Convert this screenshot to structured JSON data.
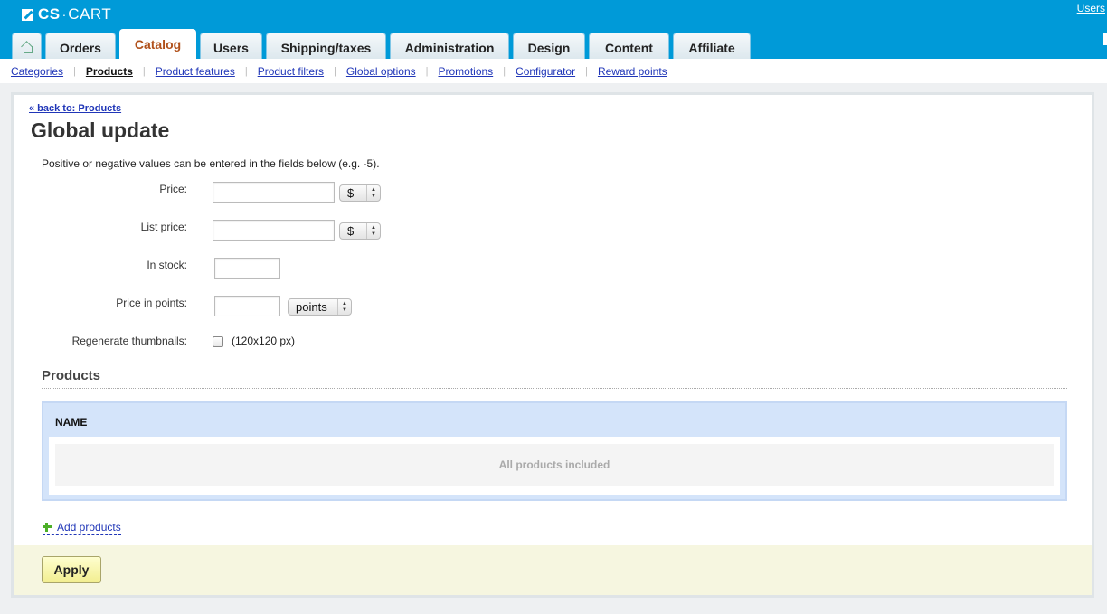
{
  "header": {
    "logo_cs": "CS",
    "logo_dot": "·",
    "logo_cart": "CART",
    "users_link": "Users",
    "tabs": [
      {
        "label": "Orders"
      },
      {
        "label": "Catalog"
      },
      {
        "label": "Users"
      },
      {
        "label": "Shipping/taxes"
      },
      {
        "label": "Administration"
      },
      {
        "label": "Design"
      },
      {
        "label": "Content"
      },
      {
        "label": "Affiliate"
      }
    ],
    "active_tab": "Catalog"
  },
  "subnav": {
    "items": [
      {
        "label": "Categories"
      },
      {
        "label": "Products"
      },
      {
        "label": "Product features"
      },
      {
        "label": "Product filters"
      },
      {
        "label": "Global options"
      },
      {
        "label": "Promotions"
      },
      {
        "label": "Configurator"
      },
      {
        "label": "Reward points"
      }
    ],
    "active": "Products"
  },
  "page": {
    "back_link": "« back to: Products",
    "title": "Global update",
    "hint": "Positive or negative values can be entered in the fields below (e.g. -5)."
  },
  "form": {
    "price_label": "Price:",
    "price_value": "",
    "price_unit": "$",
    "list_price_label": "List price:",
    "list_price_value": "",
    "list_price_unit": "$",
    "in_stock_label": "In stock:",
    "in_stock_value": "",
    "points_label": "Price in points:",
    "points_value": "",
    "points_unit": "points",
    "thumbnails_label": "Regenerate thumbnails:",
    "thumbnails_note": "(120x120 px)",
    "thumbnails_checked": false
  },
  "products": {
    "section_title": "Products",
    "column_name": "NAME",
    "empty_text": "All products included",
    "add_link": "Add products"
  },
  "footer": {
    "apply_label": "Apply"
  }
}
